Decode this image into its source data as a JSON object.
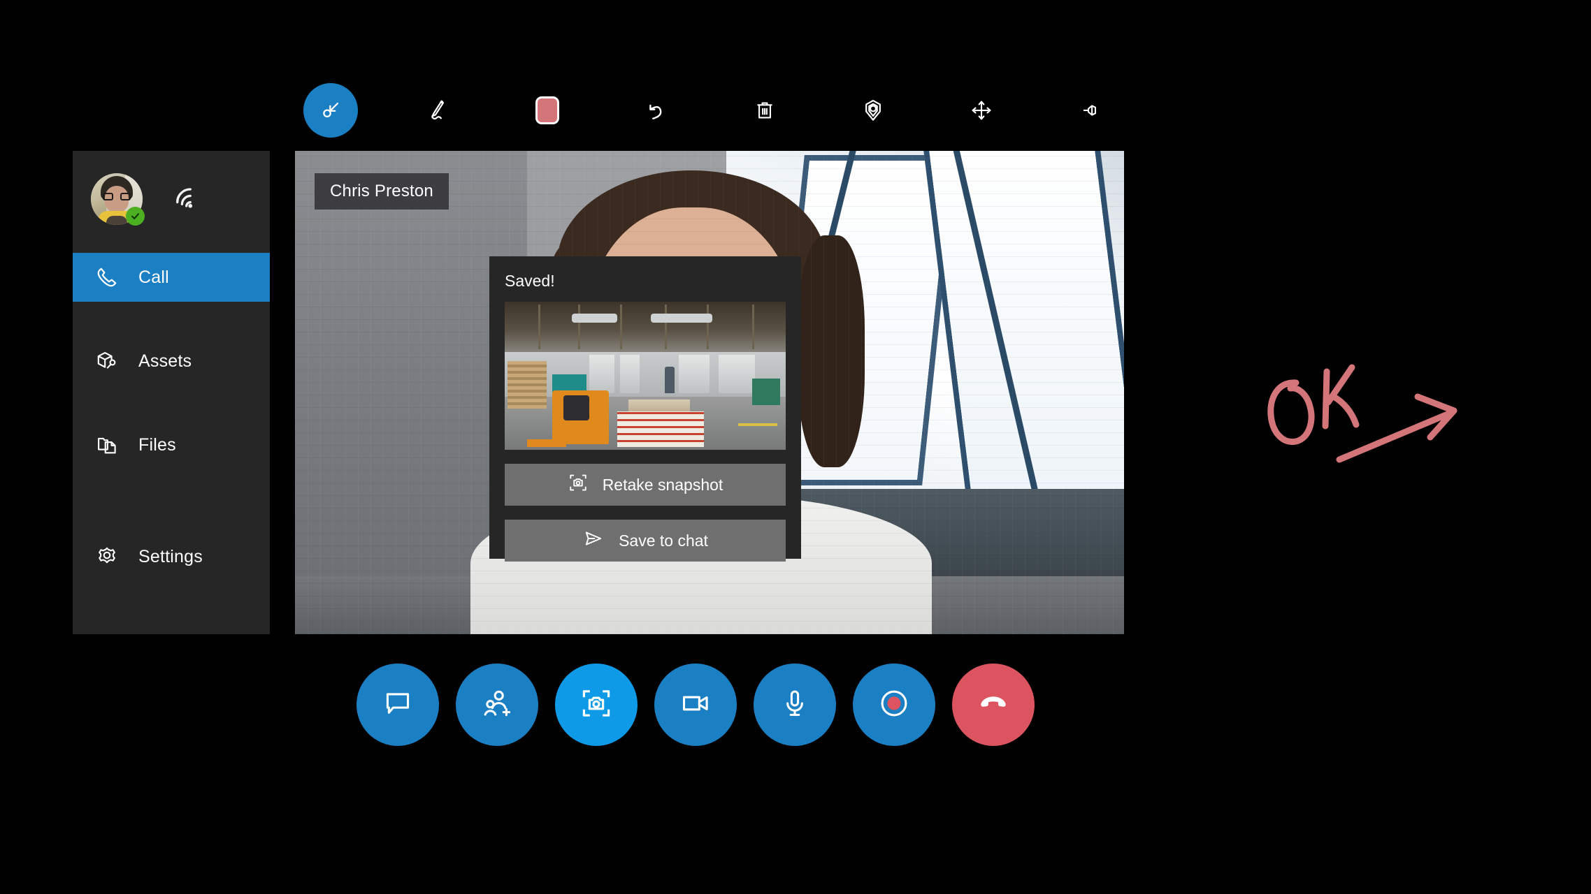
{
  "app": {
    "background_color": "#000000",
    "accent_color": "#1b7fc4",
    "panel_color": "#262626",
    "danger_color": "#dc5460",
    "annotation_color": "#d4757a"
  },
  "annotation_toolbar": {
    "tools": [
      {
        "name": "select-tool",
        "icon": "cursor-select-icon",
        "label": "Select",
        "active": true
      },
      {
        "name": "pen-tool",
        "icon": "pen-icon",
        "label": "Draw",
        "active": false
      },
      {
        "name": "color-swatch",
        "icon": "color-swatch-icon",
        "label": "Color",
        "active": false,
        "color": "#d4757a"
      },
      {
        "name": "undo-tool",
        "icon": "undo-arrow-icon",
        "label": "Undo",
        "active": false
      },
      {
        "name": "delete-tool",
        "icon": "trash-icon",
        "label": "Delete",
        "active": false
      },
      {
        "name": "anchor-tool",
        "icon": "location-marker-icon",
        "label": "Place anchor",
        "active": false
      },
      {
        "name": "move-tool",
        "icon": "move-arrows-icon",
        "label": "Move",
        "active": false
      },
      {
        "name": "pin-tool",
        "icon": "pushpin-icon",
        "label": "Pin",
        "active": false
      }
    ]
  },
  "sidebar": {
    "profile": {
      "avatar_label": "avatar",
      "presence_status": "available",
      "presence_color": "#4caf22",
      "connection_icon": "signal-strength-icon"
    },
    "items": [
      {
        "label": "Call",
        "icon": "phone-icon",
        "active": true
      },
      {
        "label": "Assets",
        "icon": "assets-icon",
        "active": false
      },
      {
        "label": "Files",
        "icon": "files-icon",
        "active": false
      },
      {
        "label": "Settings",
        "icon": "gear-icon",
        "active": false
      }
    ]
  },
  "stage": {
    "participant_name": "Chris Preston"
  },
  "snapshot_panel": {
    "title": "Saved!",
    "thumbnail_alt": "warehouse-snapshot",
    "buttons": [
      {
        "label": "Retake snapshot",
        "icon": "camera-frame-icon"
      },
      {
        "label": "Save to chat",
        "icon": "paper-plane-icon"
      }
    ]
  },
  "call_controls": [
    {
      "name": "chat-button",
      "icon": "chat-bubble-icon",
      "label": "Chat",
      "state": "default"
    },
    {
      "name": "add-participant",
      "icon": "add-person-icon",
      "label": "Add people",
      "state": "default"
    },
    {
      "name": "snapshot-button",
      "icon": "camera-frame-icon",
      "label": "Snapshot",
      "state": "active"
    },
    {
      "name": "camera-button",
      "icon": "video-camera-icon",
      "label": "Camera",
      "state": "default"
    },
    {
      "name": "microphone-button",
      "icon": "microphone-icon",
      "label": "Microphone",
      "state": "default"
    },
    {
      "name": "record-button",
      "icon": "record-icon",
      "label": "Record",
      "state": "default"
    },
    {
      "name": "end-call-button",
      "icon": "hangup-phone-icon",
      "label": "End call",
      "state": "danger"
    }
  ],
  "ink_annotation": {
    "text": "OK",
    "shape": "arrow-right",
    "color": "#d4757a"
  }
}
